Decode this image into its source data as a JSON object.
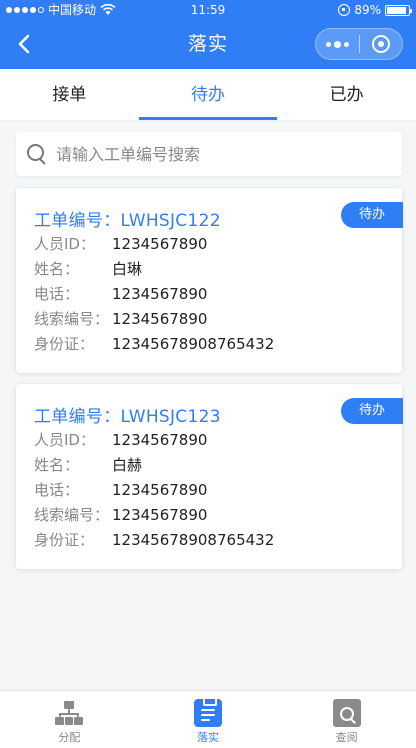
{
  "status": {
    "carrier": "中国移动",
    "time": "11:59",
    "battery": "89%",
    "battery_level": 0.89
  },
  "header": {
    "title": "落实"
  },
  "tabs": [
    {
      "label": "接单",
      "active": false
    },
    {
      "label": "待办",
      "active": true
    },
    {
      "label": "已办",
      "active": false
    }
  ],
  "search": {
    "placeholder": "请输入工单编号搜索",
    "value": ""
  },
  "fields": {
    "order_label": "工单编号：",
    "person_id": "人员ID：",
    "name": "姓名：",
    "phone": "电话：",
    "clue_no": "线索编号：",
    "id_card": "身份证："
  },
  "cards": [
    {
      "order_no": "LWHSJC122",
      "status": "待办",
      "person_id": "1234567890",
      "name": "白琳",
      "phone": "1234567890",
      "clue_no": "1234567890",
      "id_card": "12345678908765432"
    },
    {
      "order_no": "LWHSJC123",
      "status": "待办",
      "person_id": "1234567890",
      "name": "白赫",
      "phone": "1234567890",
      "clue_no": "1234567890",
      "id_card": "12345678908765432"
    }
  ],
  "bottom_nav": [
    {
      "label": "分配",
      "icon": "org-chart-icon",
      "active": false
    },
    {
      "label": "落实",
      "icon": "clipboard-icon",
      "active": true
    },
    {
      "label": "查阅",
      "icon": "search-document-icon",
      "active": false
    }
  ],
  "colors": {
    "primary": "#2f7ef5",
    "background": "#f5f6f8"
  }
}
